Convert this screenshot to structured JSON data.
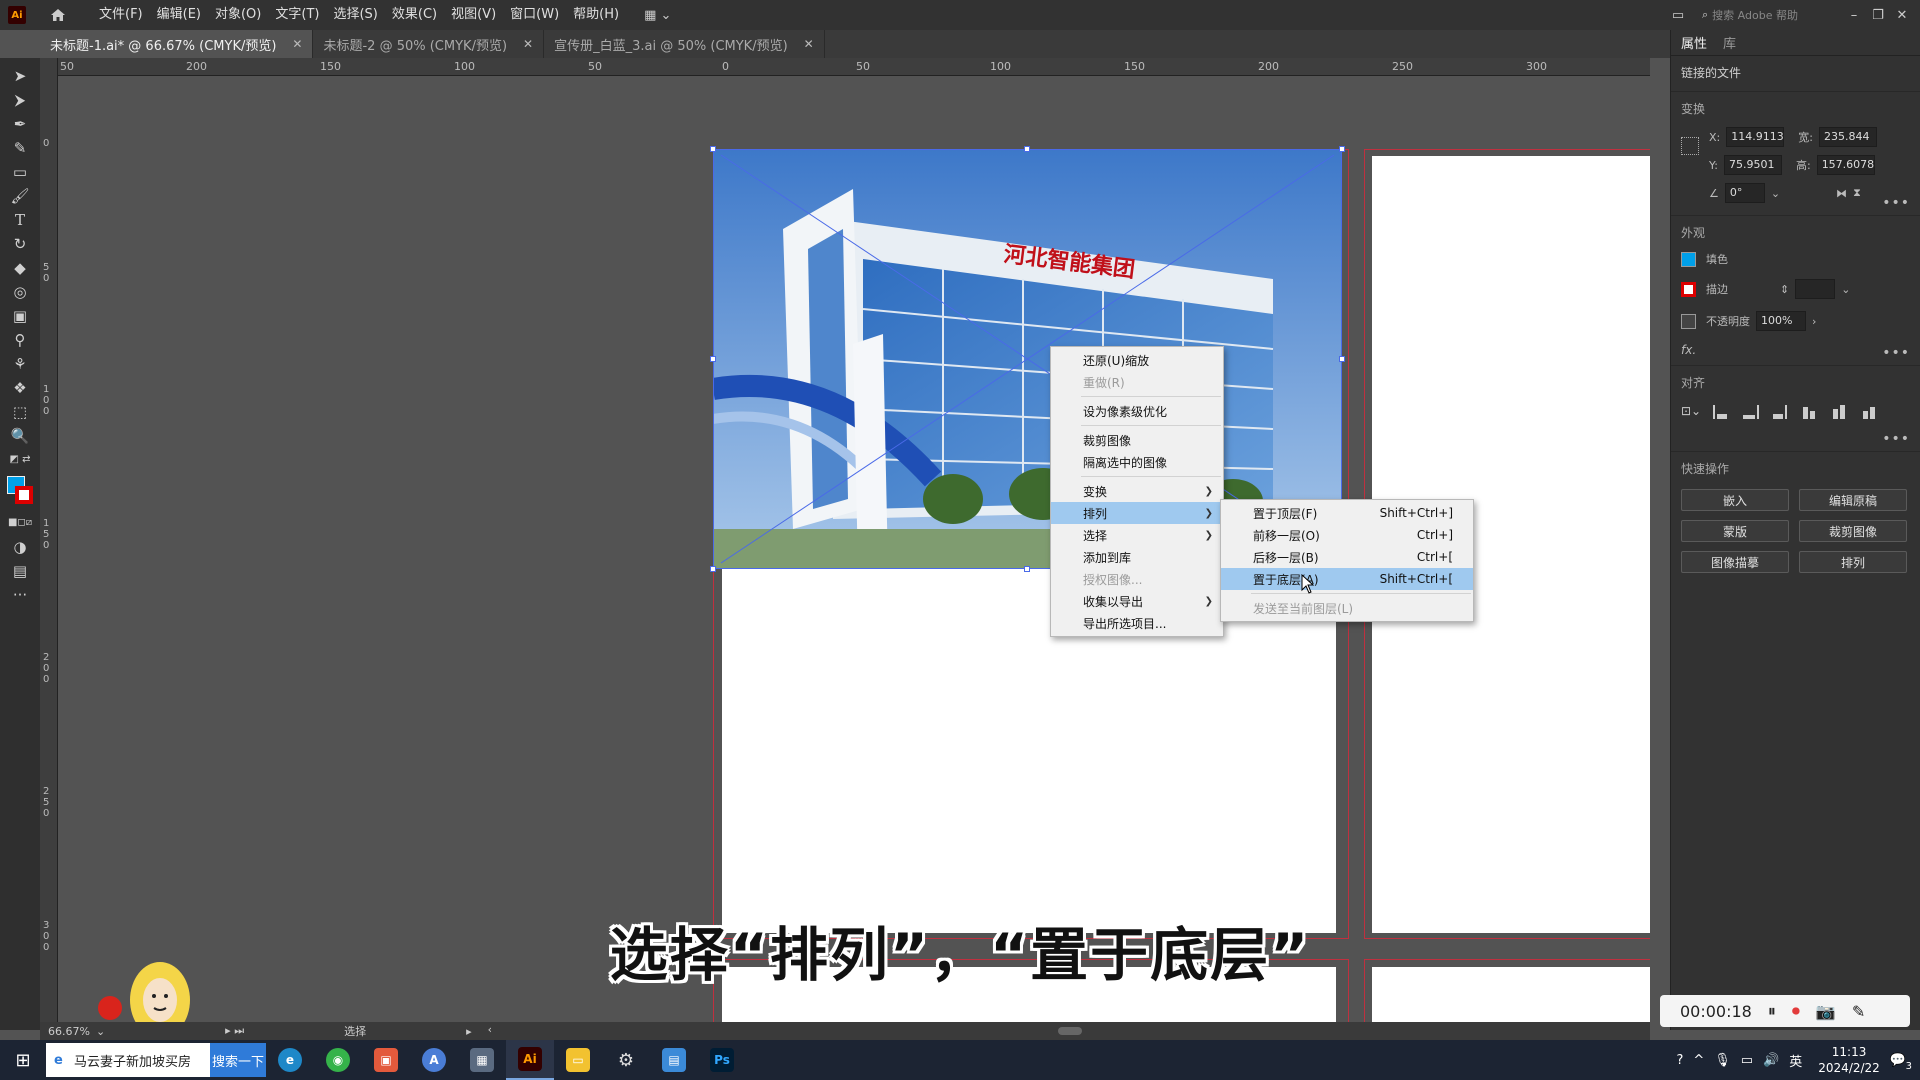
{
  "menubar": {
    "logo": "Ai",
    "items": [
      "文件(F)",
      "编辑(E)",
      "对象(O)",
      "文字(T)",
      "选择(S)",
      "效果(C)",
      "视图(V)",
      "窗口(W)",
      "帮助(H)"
    ],
    "search_placeholder": "搜索 Adobe 帮助"
  },
  "tabs": [
    {
      "label": "未标题-1.ai* @ 66.67% (CMYK/预览)",
      "active": true
    },
    {
      "label": "未标题-2 @ 50% (CMYK/预览)",
      "active": false
    },
    {
      "label": "宣传册_白蓝_3.ai @ 50% (CMYK/预览)",
      "active": false
    }
  ],
  "ruler_top": [
    "50",
    "200",
    "150",
    "100",
    "50",
    "0",
    "50",
    "100",
    "150",
    "200",
    "250",
    "300"
  ],
  "ruler_left": [
    "0",
    "50",
    "100",
    "150",
    "200",
    "250",
    "300"
  ],
  "photo": {
    "sign_text": "河北智能集团"
  },
  "context_menu": {
    "items": [
      {
        "label": "还原(U)缩放",
        "disabled": false
      },
      {
        "label": "重做(R)",
        "disabled": true
      },
      {
        "sep": true
      },
      {
        "label": "设为像素级优化",
        "disabled": false
      },
      {
        "sep": true
      },
      {
        "label": "裁剪图像",
        "disabled": false
      },
      {
        "label": "隔离选中的图像",
        "disabled": false
      },
      {
        "sep": true
      },
      {
        "label": "变换",
        "submenu": true
      },
      {
        "label": "排列",
        "submenu": true,
        "highlighted": true
      },
      {
        "label": "选择",
        "submenu": true
      },
      {
        "label": "添加到库",
        "disabled": false
      },
      {
        "label": "授权图像...",
        "disabled": true
      },
      {
        "label": "收集以导出",
        "submenu": true
      },
      {
        "label": "导出所选项目...",
        "disabled": false
      }
    ]
  },
  "submenu": {
    "items": [
      {
        "label": "置于顶层(F)",
        "shortcut": "Shift+Ctrl+]"
      },
      {
        "label": "前移一层(O)",
        "shortcut": "Ctrl+]"
      },
      {
        "label": "后移一层(B)",
        "shortcut": "Ctrl+["
      },
      {
        "label": "置于底层(A)",
        "shortcut": "Shift+Ctrl+[",
        "highlighted": true
      },
      {
        "sep": true
      },
      {
        "label": "发送至当前图层(L)",
        "shortcut": "",
        "disabled": true
      }
    ]
  },
  "panel": {
    "tabs": [
      "属性",
      "库"
    ],
    "linked_file": "链接的文件",
    "transform": {
      "heading": "变换",
      "x_label": "X:",
      "x": "114.9113",
      "y_label": "Y:",
      "y": "75.9501",
      "w_label": "宽:",
      "w": "235.844",
      "h_label": "高:",
      "h": "157.6078",
      "angle": "0°"
    },
    "appearance": {
      "heading": "外观",
      "fill": "填色",
      "stroke": "描边",
      "opacity_label": "不透明度",
      "opacity": "100%",
      "fx": "fx."
    },
    "align": {
      "heading": "对齐"
    },
    "quick_actions": {
      "heading": "快速操作",
      "buttons": [
        "嵌入",
        "编辑原稿",
        "蒙版",
        "裁剪图像",
        "图像描摹",
        "排列"
      ]
    }
  },
  "subtitle": "选择“排列”，“置于底层”",
  "statusbar": {
    "zoom": "66.67%",
    "mode": "选择"
  },
  "recorder": {
    "time": "00:00:18"
  },
  "taskbar": {
    "search_text": "马云妻子新加坡买房",
    "search_button": "搜索一下",
    "time": "11:13",
    "date": "2024/2/22",
    "lang": "英",
    "notifications": "3"
  },
  "colors": {
    "fill_swatch": "#00a0e9",
    "stroke_swatch": "#dd0000",
    "highlight": "#9fc9ef"
  }
}
